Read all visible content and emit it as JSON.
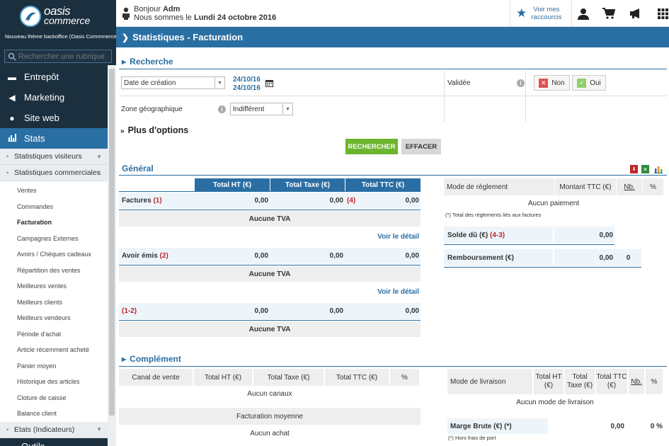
{
  "app": {
    "logo_line1": "oasis",
    "logo_line2": "commerce",
    "tagline": "Nouveau thème backoffice (Oasis Commmerce)"
  },
  "sidebar": {
    "search_placeholder": "Rechercher une rubrique",
    "nav": [
      {
        "label": "Entrepôt",
        "icon": "warehouse-icon"
      },
      {
        "label": "Marketing",
        "icon": "megaphone-icon"
      },
      {
        "label": "Site web",
        "icon": "globe-icon"
      },
      {
        "label": "Stats",
        "icon": "bar-chart-icon"
      }
    ],
    "stats_sections": {
      "visiteurs": "Statistiques visiteurs",
      "commerciales": "Statistiques commerciales",
      "etats": "Etats (Indicateurs)"
    },
    "commerciales_items": [
      "Ventes",
      "Commandes",
      "Facturation",
      "Campagnes Externes",
      "Avoirs / Chèques cadeaux",
      "Répartition des ventes",
      "Meilleures ventes",
      "Meilleurs clients",
      "Meilleurs vendeurs",
      "Période d'achat",
      "Article récemment acheté",
      "Panier moyen",
      "Historique des articles",
      "Cloture de caisse",
      "Balance client"
    ],
    "last_item_partial": "Outils"
  },
  "topbar": {
    "greeting": "Bonjour",
    "user": "Adm",
    "date_prefix": "Nous sommes le",
    "date": "Lundi 24 octobre 2016",
    "shortcut_line1": "Voir mes",
    "shortcut_line2": "raccourcis"
  },
  "page": {
    "title": "Statistiques - Facturation"
  },
  "recherche": {
    "title": "Recherche",
    "date_type": "Date de création",
    "date_from": "24/10/16",
    "date_to": "24/10/16",
    "validee_label": "Validée",
    "non_label": "Non",
    "oui_label": "Oui",
    "zone_label": "Zone géographique",
    "zone_value": "Indifférent",
    "more_options": "Plus d'options",
    "search_btn": "RECHERCHER",
    "clear_btn": "EFFACER"
  },
  "general": {
    "title": "Général",
    "headers": [
      "Total HT (€)",
      "Total Taxe (€)",
      "Total TTC (€)"
    ],
    "factures": {
      "label": "Factures",
      "ref": "(1)",
      "ht": "0,00",
      "taxe": "0,00",
      "ttc_ref": "(4)",
      "ttc": "0,00"
    },
    "aucune_tva": "Aucune TVA",
    "voir_detail": "Voir le détail",
    "avoir": {
      "label": "Avoir émis",
      "ref": "(2)",
      "ht": "0,00",
      "taxe": "0,00",
      "ttc": "0,00"
    },
    "diff": {
      "label": "(1-2)",
      "ht": "0,00",
      "taxe": "0,00",
      "ttc": "0,00"
    },
    "reglement_headers": [
      "Mode de réglement",
      "Montant TTC (€)",
      "Nb.",
      "%"
    ],
    "aucun_paiement": "Aucun paiement",
    "note": "(*) Total des réglements liés aux factures",
    "solde_label": "Solde dû (€)",
    "solde_ref": "(4-3)",
    "solde_value": "0,00",
    "remb_label": "Remboursement (€)",
    "remb_value": "0,00",
    "remb_nb": "0"
  },
  "complement": {
    "title": "Complément",
    "canal_headers": [
      "Canal de vente",
      "Total HT (€)",
      "Total Taxe (€)",
      "Total TTC (€)",
      "%"
    ],
    "aucun_canaux": "Aucun canaux",
    "fact_moyenne": "Facturation moyenne",
    "aucun_achat": "Aucun achat",
    "livraison_headers": [
      "Mode de livraison",
      "Total HT (€)",
      "Total Taxe (€)",
      "Total TTC (€)",
      "Nb.",
      "%"
    ],
    "aucun_livraison": "Aucun mode de livraison",
    "marge_label": "Marge Brute (€) (*)",
    "marge_value": "0,00",
    "marge_pct": "0 %",
    "hors_frais": "(*) Hors frais de port"
  },
  "colors": {
    "sidebar": "#1b2f3e",
    "accent": "#2a6fa3",
    "green": "#6cb52d",
    "red": "#c0262d"
  }
}
